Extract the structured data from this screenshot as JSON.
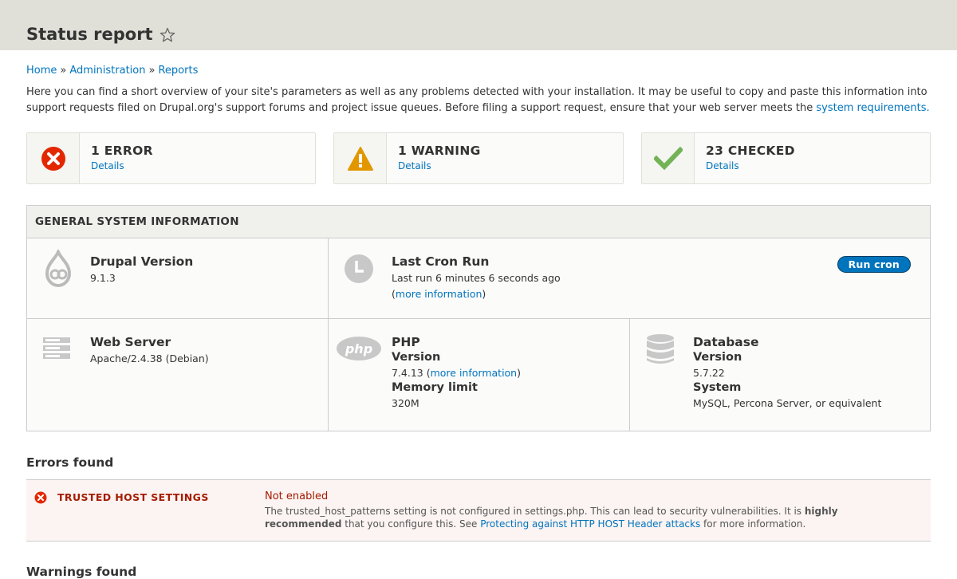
{
  "header": {
    "title": "Status report"
  },
  "breadcrumb": [
    "Home",
    "Administration",
    "Reports"
  ],
  "intro": {
    "text": "Here you can find a short overview of your site's parameters as well as any problems detected with your installation. It may be useful to copy and paste this information into support requests filed on Drupal.org's support forums and project issue queues. Before filing a support request, ensure that your web server meets the",
    "link": "system requirements.",
    "after": ""
  },
  "summary": [
    {
      "count": "1 ERROR",
      "details": "Details",
      "icon": "error-icon",
      "color": "#e32700"
    },
    {
      "count": "1 WARNING",
      "details": "Details",
      "icon": "warning-icon",
      "color": "#e29700"
    },
    {
      "count": "23 CHECKED",
      "details": "Details",
      "icon": "check-icon",
      "color": "#73b355"
    }
  ],
  "general": {
    "heading": "GENERAL SYSTEM INFORMATION",
    "drupal": {
      "title": "Drupal Version",
      "value": "9.1.3"
    },
    "cron": {
      "title": "Last Cron Run",
      "last_run": "Last run 6 minutes 6 seconds ago",
      "open_paren": "(",
      "link": "more information",
      "close_paren": ")",
      "button": "Run cron"
    },
    "webserver": {
      "title": "Web Server",
      "value": "Apache/2.4.38 (Debian)"
    },
    "php": {
      "title": "PHP",
      "version_label": "Version",
      "version": "7.4.13 (",
      "version_link": "more information",
      "version_close": ")",
      "memory_label": "Memory limit",
      "memory": "320M"
    },
    "database": {
      "title": "Database",
      "version_label": "Version",
      "version": "5.7.22",
      "system_label": "System",
      "system": "MySQL, Percona Server, or equivalent"
    }
  },
  "errors": {
    "title": "Errors found",
    "items": [
      {
        "name": "TRUSTED HOST SETTINGS",
        "status": "Not enabled",
        "desc_1": "The trusted_host_patterns setting is not configured in settings.php. This can lead to security vulnerabilities. It is ",
        "desc_bold": "highly recommended",
        "desc_2": " that you configure this. See ",
        "desc_link": "Protecting against HTTP HOST Header attacks",
        "desc_3": " for more information."
      }
    ]
  },
  "warnings": {
    "title": "Warnings found"
  },
  "colors": {
    "link": "#0074bd",
    "error": "#a51b00",
    "header_bg": "#e0e0d8",
    "button": "#0074bd"
  }
}
